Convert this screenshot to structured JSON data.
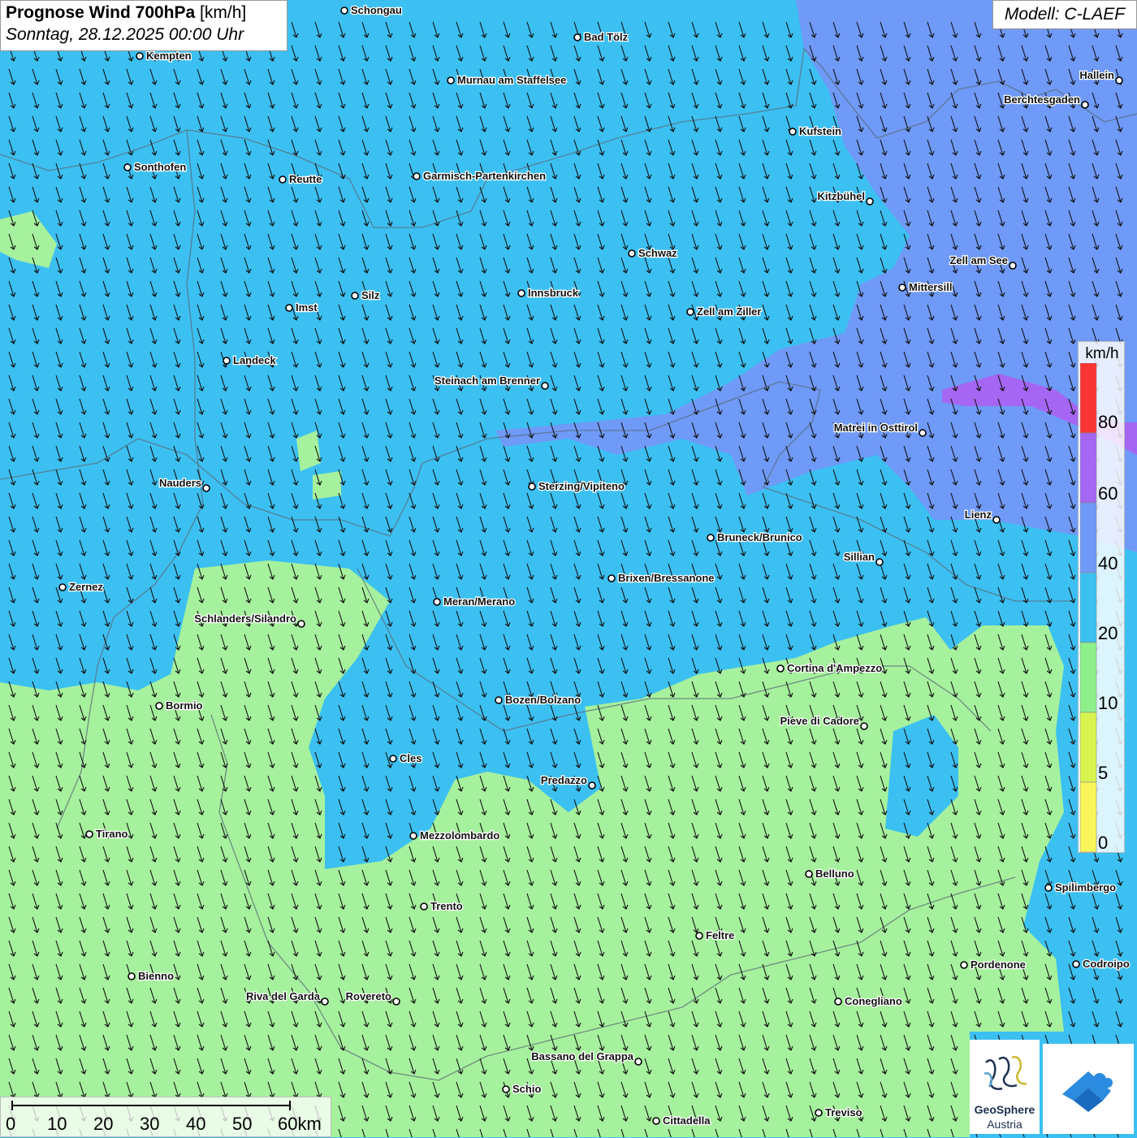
{
  "header": {
    "title_main": "Prognose Wind 700hPa",
    "title_unit": "[km/h]",
    "subtitle": "Sonntag, 28.12.2025 00:00 Uhr"
  },
  "model_label": "Modell: C-LAEF",
  "legend": {
    "unit": "km/h",
    "labels": [
      "80",
      "60",
      "40",
      "20",
      "10",
      "5",
      "0"
    ],
    "colors": [
      "#fb3434",
      "#a566f3",
      "#6f9af7",
      "#3cc0f2",
      "#8ef08a",
      "#d9f44f",
      "#f8f65a"
    ]
  },
  "scalebar": {
    "labels": [
      "0",
      "10",
      "20",
      "30",
      "40",
      "50",
      "60km"
    ]
  },
  "logos": {
    "geosphere_line1": "GeoSphere",
    "geosphere_line2": "Austria",
    "geosphere_icon": "geosphere-logo-icon",
    "warn_icon": "warning-app-logo-icon"
  },
  "wind_direction": "north-northwest",
  "cities": [
    {
      "name": "Schongau"
    },
    {
      "name": "Bad Tölz"
    },
    {
      "name": "Kempten"
    },
    {
      "name": "Murnau am Staffelsee"
    },
    {
      "name": "Hallein"
    },
    {
      "name": "Berchtesgaden"
    },
    {
      "name": "Kufstein"
    },
    {
      "name": "Sonthofen"
    },
    {
      "name": "Reutte"
    },
    {
      "name": "Garmisch-Partenkirchen"
    },
    {
      "name": "Kitzbühel"
    },
    {
      "name": "Schwaz"
    },
    {
      "name": "Zell am See"
    },
    {
      "name": "Mittersill"
    },
    {
      "name": "Innsbruck"
    },
    {
      "name": "Silz"
    },
    {
      "name": "Imst"
    },
    {
      "name": "Zell am Ziller"
    },
    {
      "name": "Landeck"
    },
    {
      "name": "Steinach am Brenner"
    },
    {
      "name": "Matrei in Osttirol"
    },
    {
      "name": "Nauders"
    },
    {
      "name": "Sterzing/Vipiteno"
    },
    {
      "name": "Lienz"
    },
    {
      "name": "Bruneck/Brunico"
    },
    {
      "name": "Sillian"
    },
    {
      "name": "Brixen/Bressanone"
    },
    {
      "name": "Zernez"
    },
    {
      "name": "Meran/Merano"
    },
    {
      "name": "Schlanders/Silandro"
    },
    {
      "name": "Cortina d'Ampezzo"
    },
    {
      "name": "Bozen/Bolzano"
    },
    {
      "name": "Bormio"
    },
    {
      "name": "Pieve di Cadore"
    },
    {
      "name": "Cles"
    },
    {
      "name": "Predazzo"
    },
    {
      "name": "Tirano"
    },
    {
      "name": "Mezzolombardo"
    },
    {
      "name": "Belluno"
    },
    {
      "name": "Spilimbergo"
    },
    {
      "name": "Trento"
    },
    {
      "name": "Feltre"
    },
    {
      "name": "Bienno"
    },
    {
      "name": "Pordenone"
    },
    {
      "name": "Codroipo"
    },
    {
      "name": "Riva del Garda"
    },
    {
      "name": "Rovereto"
    },
    {
      "name": "Conegliano"
    },
    {
      "name": "Bassano del Grappa"
    },
    {
      "name": "Schio"
    },
    {
      "name": "Treviso"
    },
    {
      "name": "Cittadella"
    }
  ]
}
